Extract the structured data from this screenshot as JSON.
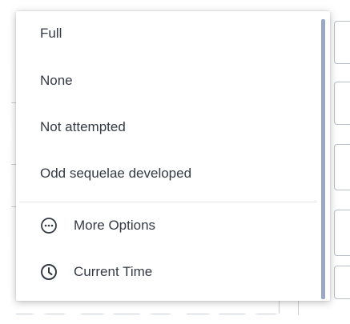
{
  "dropdown": {
    "options": [
      {
        "label": "Full"
      },
      {
        "label": "None"
      },
      {
        "label": "Not attempted"
      },
      {
        "label": "Odd sequelae developed"
      }
    ],
    "actions": [
      {
        "label": "More Options",
        "icon": "more-options-icon"
      },
      {
        "label": "Current Time",
        "icon": "clock-icon"
      }
    ]
  },
  "colors": {
    "text": "#333a45",
    "scrollbar": "#9ba8c4",
    "divider": "#e2e5ea"
  }
}
